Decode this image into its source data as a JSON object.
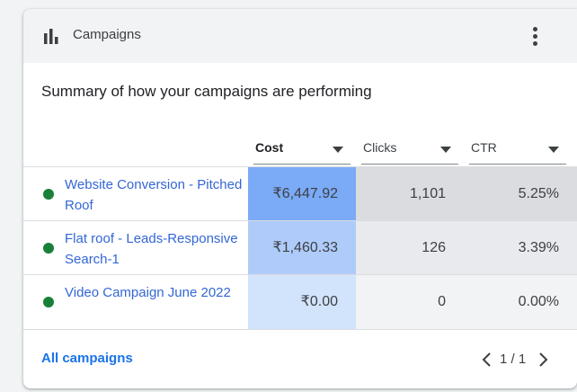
{
  "header": {
    "title": "Campaigns",
    "icon": "bar-chart-icon",
    "menu_icon": "more-vert-icon"
  },
  "summary": "Summary of how your campaigns are performing",
  "columns": [
    {
      "label": "Cost",
      "bold": true
    },
    {
      "label": "Clicks",
      "bold": false
    },
    {
      "label": "CTR",
      "bold": false
    }
  ],
  "rows": [
    {
      "name": "Website Conversion - Pitched Roof",
      "status": "enabled",
      "cost": "₹6,447.92",
      "clicks": "1,101",
      "ctr": "5.25%"
    },
    {
      "name": "Flat roof - Leads-Responsive Search-1",
      "status": "enabled",
      "cost": "₹1,460.33",
      "clicks": "126",
      "ctr": "3.39%"
    },
    {
      "name": "Video Campaign June 2022",
      "status": "enabled",
      "cost": "₹0.00",
      "clicks": "0",
      "ctr": "0.00%"
    }
  ],
  "heat_colors": {
    "cost": [
      "#7baaf7",
      "#aecbfa",
      "#d2e3fc"
    ],
    "clicks": [
      "#dadce0",
      "#e8eaed",
      "#f1f3f4"
    ],
    "ctr": [
      "#dadce0",
      "#e8eaed",
      "#f1f3f4"
    ]
  },
  "colors": {
    "status_green": "#188038",
    "link_blue": "#3367d6",
    "accent": "#1a73e8"
  },
  "footer": {
    "link_label": "All campaigns",
    "page_label": "1 / 1"
  }
}
